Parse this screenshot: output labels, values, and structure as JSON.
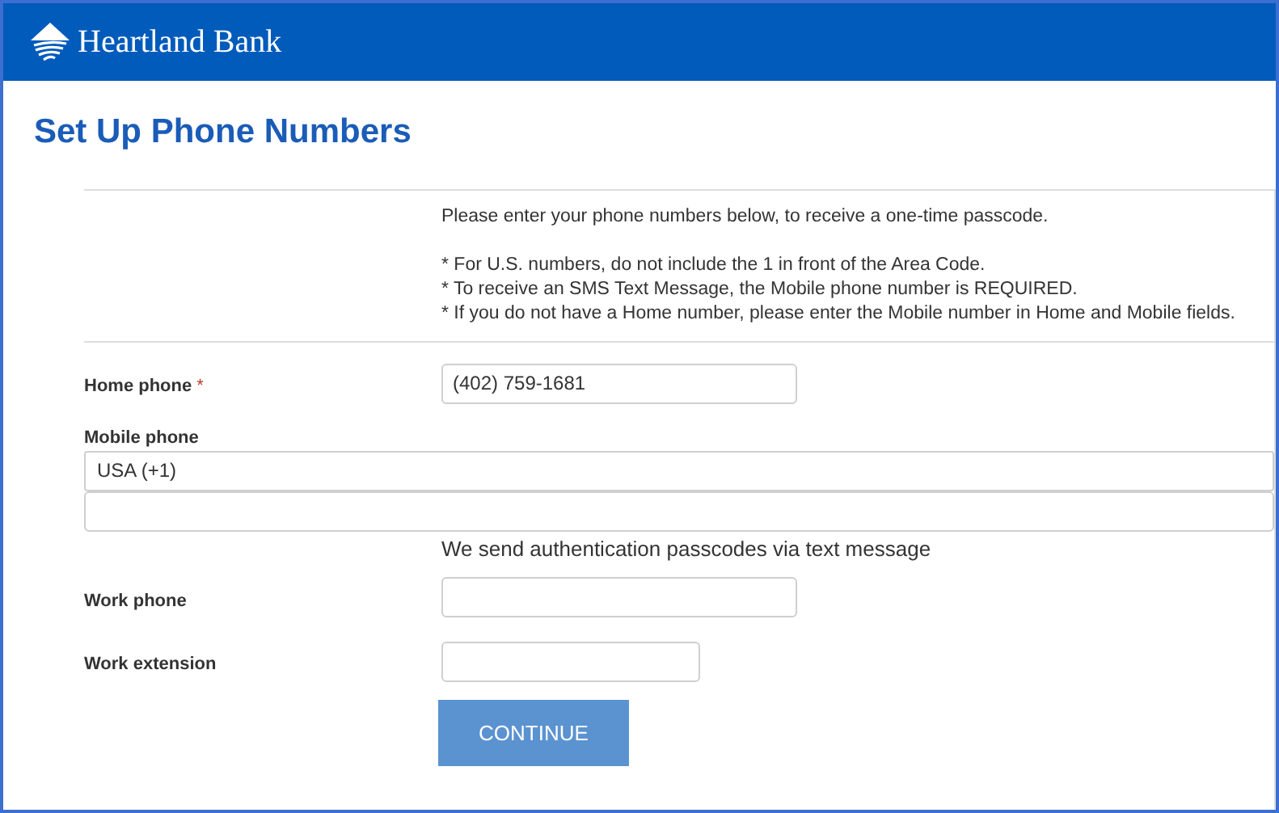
{
  "header": {
    "brand": "Heartland Bank"
  },
  "page": {
    "title": "Set Up Phone Numbers"
  },
  "instructions": {
    "intro": "Please enter your phone numbers below, to receive a one-time passcode.",
    "notes": [
      "* For U.S. numbers, do not include the 1 in front of the Area Code.",
      "* To receive an SMS Text Message, the Mobile phone number is REQUIRED.",
      "* If you do not have a Home number, please enter the Mobile number in Home and Mobile fields."
    ]
  },
  "home_phone": {
    "label": "Home phone",
    "required_mark": "*",
    "value": "(402) 759-1681"
  },
  "mobile_phone": {
    "label": "Mobile phone",
    "country": "USA (+1)",
    "note": "We send authentication passcodes via text message"
  },
  "work_phone": {
    "label": "Work phone"
  },
  "work_extension": {
    "label": "Work extension"
  },
  "buttons": [
    "CONTINUE"
  ]
}
